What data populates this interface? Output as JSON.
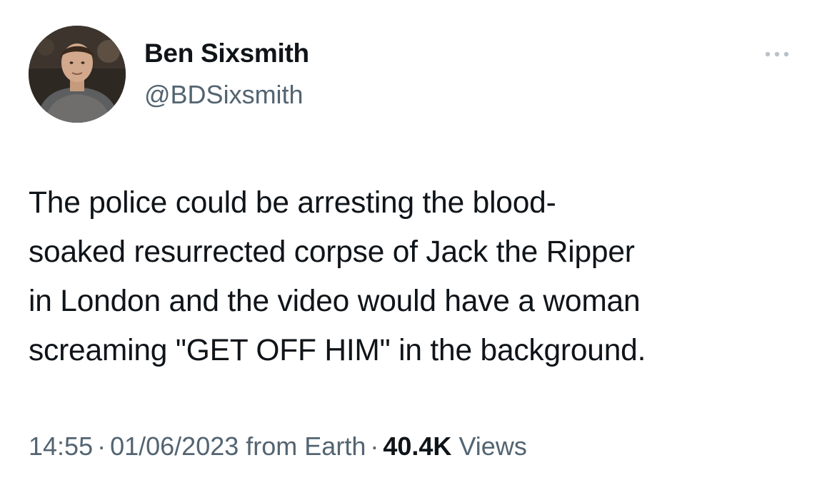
{
  "author": {
    "name": "Ben Sixsmith",
    "handle": "@BDSixsmith",
    "avatar_icon": "profile-photo"
  },
  "more_icon": "ellipsis-icon",
  "tweet": {
    "lines": [
      "The police could be arresting the blood-",
      "soaked resurrected corpse of Jack the Ripper",
      "in London and the video would have a woman",
      "screaming \"GET OFF HIM\" in the background."
    ]
  },
  "meta": {
    "time": "14:55",
    "separator": "·",
    "date": "01/06/2023",
    "source": "from Earth",
    "views_count": "40.4K",
    "views_label": "Views"
  },
  "colors": {
    "text": "#0f1419",
    "secondary": "#536471"
  }
}
